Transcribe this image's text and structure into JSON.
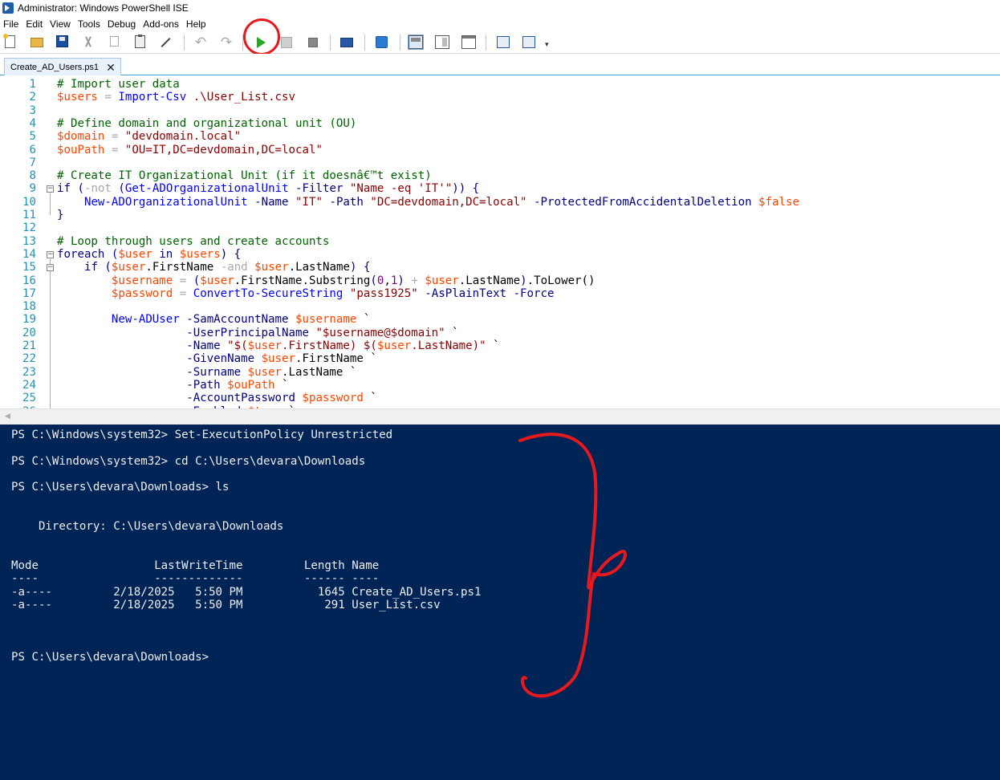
{
  "window": {
    "title": "Administrator: Windows PowerShell ISE"
  },
  "menu": [
    "File",
    "Edit",
    "View",
    "Tools",
    "Debug",
    "Add-ons",
    "Help"
  ],
  "toolbar": {
    "icons": [
      "new-script-icon",
      "open-icon",
      "save-icon",
      "cut-icon",
      "copy-icon",
      "paste-icon",
      "clear-console-icon",
      "undo-icon",
      "redo-icon",
      "run-script-icon",
      "run-selection-icon",
      "stop-icon",
      "remote-powershell-icon",
      "start-powershell-icon",
      "script-pane-top-icon",
      "script-pane-right-icon",
      "script-pane-maximized-icon",
      "show-script-pane-icon",
      "show-commands-icon",
      "toolbar-overflow-icon"
    ],
    "undo_glyph": "↶",
    "redo_glyph": "↷",
    "overflow_glyph": "▾"
  },
  "tab": {
    "label": "Create_AD_Users.ps1",
    "close": "✕"
  },
  "editor": {
    "lines": [
      {
        "n": "1",
        "y": 0,
        "tokens": [
          [
            "c-com",
            "# Import user data"
          ]
        ]
      },
      {
        "n": "2",
        "y": 1,
        "tokens": [
          [
            "c-var",
            "$users"
          ],
          [
            "c-op",
            " = "
          ],
          [
            "c-cmd",
            "Import-Csv"
          ],
          [
            "c-str",
            " .\\User_List.csv"
          ]
        ]
      },
      {
        "n": "3",
        "y": 2,
        "tokens": []
      },
      {
        "n": "4",
        "y": 3,
        "tokens": [
          [
            "c-com",
            "# Define domain and organizational unit (OU)"
          ]
        ]
      },
      {
        "n": "5",
        "y": 4,
        "tokens": [
          [
            "c-var",
            "$domain"
          ],
          [
            "c-op",
            " = "
          ],
          [
            "c-str",
            "\"devdomain.local\""
          ]
        ]
      },
      {
        "n": "6",
        "y": 5,
        "tokens": [
          [
            "c-var",
            "$ouPath"
          ],
          [
            "c-op",
            " = "
          ],
          [
            "c-str",
            "\"OU=IT,DC=devdomain,DC=local\""
          ]
        ]
      },
      {
        "n": "7",
        "y": 6,
        "tokens": []
      },
      {
        "n": "8",
        "y": 7,
        "tokens": [
          [
            "c-com",
            "# Create IT Organizational Unit (if it doesnâ€™t exist)"
          ]
        ]
      },
      {
        "n": "9",
        "y": 8,
        "tokens": [
          [
            "c-kw",
            "if"
          ],
          [
            "c-par",
            " ("
          ],
          [
            "c-op",
            "-not"
          ],
          [
            "c-par",
            " ("
          ],
          [
            "c-cmd",
            "Get-ADOrganizationalUnit"
          ],
          [
            "c-prm",
            " -Filter"
          ],
          [
            "c-str",
            " \"Name -eq 'IT'\""
          ],
          [
            "c-par",
            ")) {"
          ]
        ]
      },
      {
        "n": "10",
        "y": 9,
        "tokens": [
          [
            "c-mem",
            "    "
          ],
          [
            "c-cmd",
            "New-ADOrganizationalUnit"
          ],
          [
            "c-prm",
            " -Name"
          ],
          [
            "c-str",
            " \"IT\""
          ],
          [
            "c-prm",
            " -Path"
          ],
          [
            "c-str",
            " \"DC=devdomain,DC=local\""
          ],
          [
            "c-prm",
            " -ProtectedFromAccidentalDeletion"
          ],
          [
            "c-var",
            " $false"
          ]
        ]
      },
      {
        "n": "11",
        "y": 10,
        "tokens": [
          [
            "c-par",
            "}"
          ]
        ]
      },
      {
        "n": "12",
        "y": 11,
        "tokens": []
      },
      {
        "n": "13",
        "y": 12,
        "tokens": [
          [
            "c-com",
            "# Loop through users and create accounts"
          ]
        ]
      },
      {
        "n": "14",
        "y": 13,
        "tokens": [
          [
            "c-kw",
            "foreach"
          ],
          [
            "c-par",
            " ("
          ],
          [
            "c-var",
            "$user"
          ],
          [
            "c-kw",
            " in"
          ],
          [
            "c-var",
            " $users"
          ],
          [
            "c-par",
            ") {"
          ]
        ]
      },
      {
        "n": "15",
        "y": 14,
        "tokens": [
          [
            "c-mem",
            "    "
          ],
          [
            "c-kw",
            "if"
          ],
          [
            "c-par",
            " ("
          ],
          [
            "c-var",
            "$user"
          ],
          [
            "c-mem",
            "."
          ],
          [
            "c-mem",
            "FirstName"
          ],
          [
            "c-op",
            " -and"
          ],
          [
            "c-var",
            " $user"
          ],
          [
            "c-mem",
            ".LastName"
          ],
          [
            "c-par",
            ") {"
          ]
        ]
      },
      {
        "n": "16",
        "y": 15,
        "tokens": [
          [
            "c-mem",
            "        "
          ],
          [
            "c-var",
            "$username"
          ],
          [
            "c-op",
            " = "
          ],
          [
            "c-par",
            "("
          ],
          [
            "c-var",
            "$user"
          ],
          [
            "c-mem",
            ".FirstName.Substring"
          ],
          [
            "c-par",
            "("
          ],
          [
            "c-num",
            "0"
          ],
          [
            "c-mem",
            ","
          ],
          [
            "c-num",
            "1"
          ],
          [
            "c-par",
            ")"
          ],
          [
            "c-op",
            " + "
          ],
          [
            "c-var",
            "$user"
          ],
          [
            "c-mem",
            ".LastName"
          ],
          [
            "c-par",
            ")"
          ],
          [
            "c-mem",
            ".ToLower()"
          ]
        ]
      },
      {
        "n": "17",
        "y": 16,
        "tokens": [
          [
            "c-mem",
            "        "
          ],
          [
            "c-var",
            "$password"
          ],
          [
            "c-op",
            " = "
          ],
          [
            "c-cmd",
            "ConvertTo-SecureString"
          ],
          [
            "c-str",
            " \"pass1925\""
          ],
          [
            "c-prm",
            " -AsPlainText"
          ],
          [
            "c-prm",
            " -Force"
          ]
        ]
      },
      {
        "n": "18",
        "y": 17,
        "tokens": []
      },
      {
        "n": "19",
        "y": 18,
        "tokens": [
          [
            "c-mem",
            "        "
          ],
          [
            "c-cmd",
            "New-ADUser"
          ],
          [
            "c-prm",
            " -SamAccountName"
          ],
          [
            "c-var",
            " $username"
          ],
          [
            "c-mem",
            " `"
          ]
        ]
      },
      {
        "n": "20",
        "y": 19,
        "tokens": [
          [
            "c-mem",
            "                   "
          ],
          [
            "c-prm",
            "-UserPrincipalName"
          ],
          [
            "c-str",
            " \"$username@$domain\""
          ],
          [
            "c-mem",
            " `"
          ]
        ]
      },
      {
        "n": "21",
        "y": 20,
        "tokens": [
          [
            "c-mem",
            "                   "
          ],
          [
            "c-prm",
            "-Name"
          ],
          [
            "c-str",
            " \"$("
          ],
          [
            "c-var",
            "$user"
          ],
          [
            "c-str",
            ".FirstName) $("
          ],
          [
            "c-var",
            "$user"
          ],
          [
            "c-str",
            ".LastName)\""
          ],
          [
            "c-mem",
            " `"
          ]
        ]
      },
      {
        "n": "22",
        "y": 21,
        "tokens": [
          [
            "c-mem",
            "                   "
          ],
          [
            "c-prm",
            "-GivenName"
          ],
          [
            "c-var",
            " $user"
          ],
          [
            "c-mem",
            ".FirstName `"
          ]
        ]
      },
      {
        "n": "23",
        "y": 22,
        "tokens": [
          [
            "c-mem",
            "                   "
          ],
          [
            "c-prm",
            "-Surname"
          ],
          [
            "c-var",
            " $user"
          ],
          [
            "c-mem",
            ".LastName `"
          ]
        ]
      },
      {
        "n": "24",
        "y": 23,
        "tokens": [
          [
            "c-mem",
            "                   "
          ],
          [
            "c-prm",
            "-Path"
          ],
          [
            "c-var",
            " $ouPath"
          ],
          [
            "c-mem",
            " `"
          ]
        ]
      },
      {
        "n": "25",
        "y": 24,
        "tokens": [
          [
            "c-mem",
            "                   "
          ],
          [
            "c-prm",
            "-AccountPassword"
          ],
          [
            "c-var",
            " $password"
          ],
          [
            "c-mem",
            " `"
          ]
        ]
      },
      {
        "n": "26",
        "y": 25,
        "tokens": [
          [
            "c-mem",
            "                   "
          ],
          [
            "c-prm",
            "-Enabled"
          ],
          [
            "c-var",
            " $true"
          ],
          [
            "c-mem",
            " `"
          ]
        ]
      }
    ],
    "folds": [
      {
        "y": 8,
        "end": 10
      },
      {
        "y": 13,
        "end": 25
      },
      {
        "y": 14,
        "end": 25
      }
    ]
  },
  "console": {
    "lines": [
      {
        "row": 0,
        "text": "PS C:\\Windows\\system32> Set-ExecutionPolicy Unrestricted"
      },
      {
        "row": 2,
        "text": "PS C:\\Windows\\system32> cd C:\\Users\\devara\\Downloads"
      },
      {
        "row": 4,
        "text": "PS C:\\Users\\devara\\Downloads> ls"
      },
      {
        "row": 7,
        "text": "    Directory: C:\\Users\\devara\\Downloads"
      },
      {
        "row": 10,
        "text": "Mode                 LastWriteTime         Length Name"
      },
      {
        "row": 11,
        "text": "----                 -------------         ------ ----"
      },
      {
        "row": 12,
        "text": "-a----         2/18/2025   5:50 PM           1645 Create_AD_Users.ps1"
      },
      {
        "row": 13,
        "text": "-a----         2/18/2025   5:50 PM            291 User_List.csv"
      },
      {
        "row": 17,
        "text": "PS C:\\Users\\devara\\Downloads>"
      }
    ]
  },
  "colors": {
    "console_bg": "#012456",
    "console_fg": "#eeedf0",
    "annotation_red": "#e8191c",
    "run_green": "#29a52a"
  }
}
